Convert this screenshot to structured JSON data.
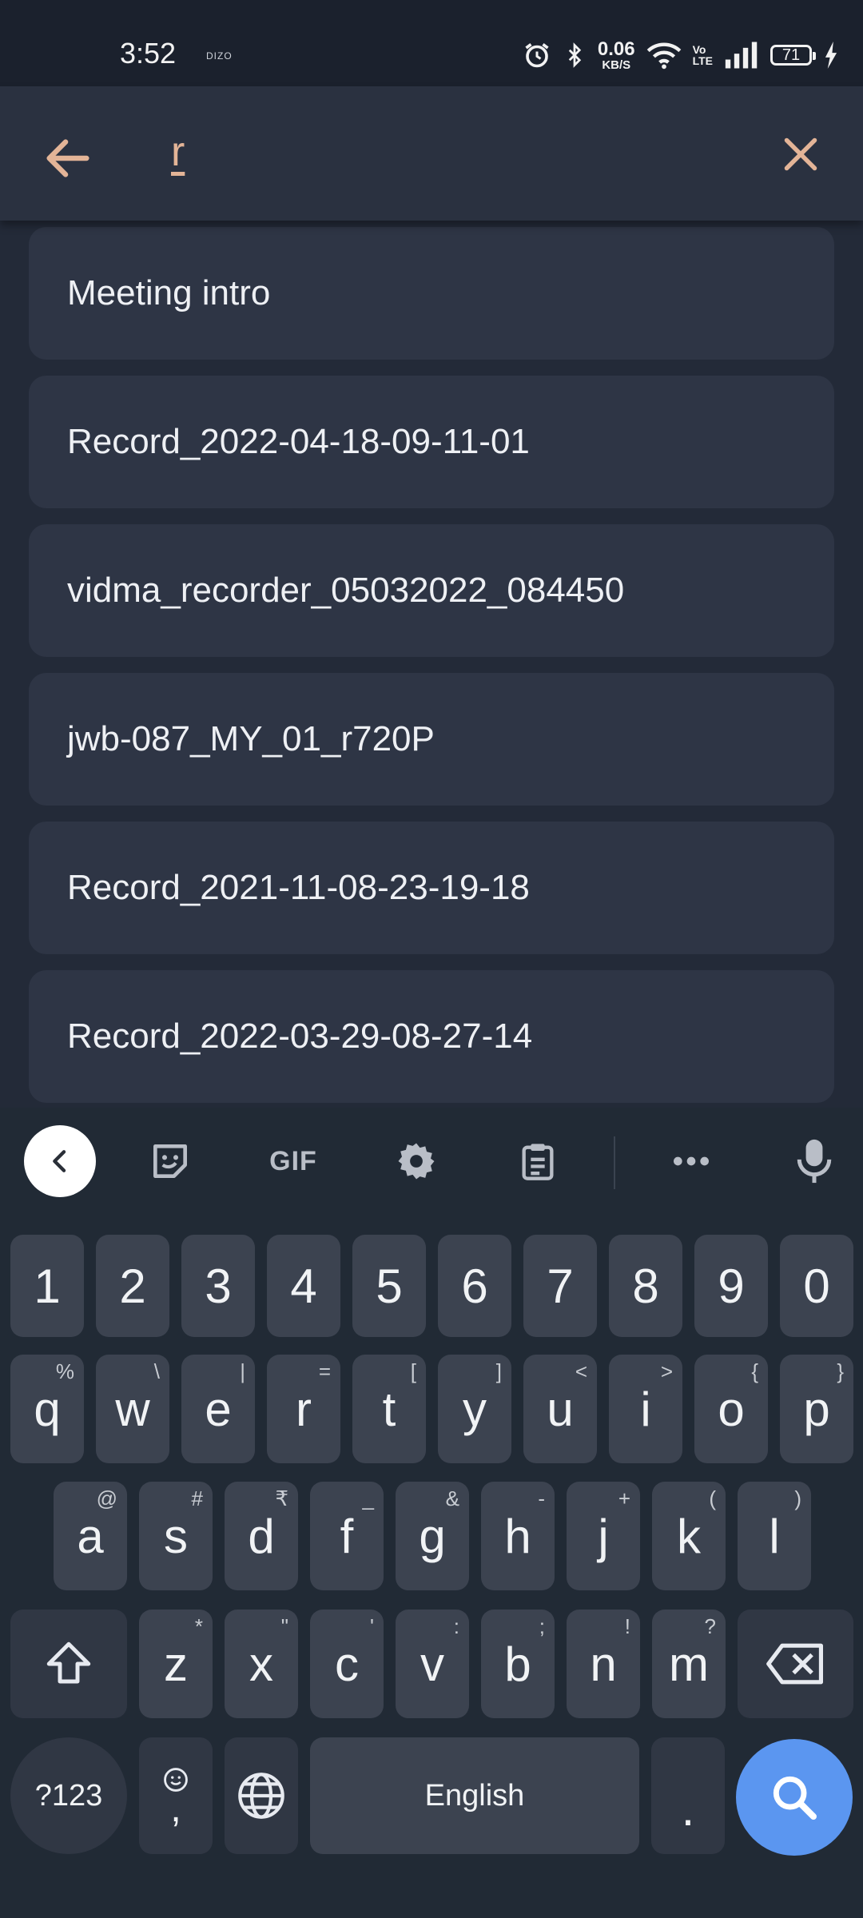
{
  "status_bar": {
    "time": "3:52",
    "carrier_label": "DIZO",
    "speed_value": "0.06",
    "speed_unit": "KB/S",
    "volte_top": "Vo",
    "volte_bottom": "LTE",
    "battery": "71"
  },
  "search": {
    "query": "r"
  },
  "results": [
    "Meeting intro",
    "Record_2022-04-18-09-11-01",
    "vidma_recorder_05032022_084450",
    "jwb-087_MY_01_r720P",
    "Record_2021-11-08-23-19-18",
    "Record_2022-03-29-08-27-14"
  ],
  "keyboard": {
    "toolbar": {
      "gif_label": "GIF"
    },
    "number_row": [
      "1",
      "2",
      "3",
      "4",
      "5",
      "6",
      "7",
      "8",
      "9",
      "0"
    ],
    "row1": [
      {
        "k": "q",
        "s": "%"
      },
      {
        "k": "w",
        "s": "\\"
      },
      {
        "k": "e",
        "s": "|"
      },
      {
        "k": "r",
        "s": "="
      },
      {
        "k": "t",
        "s": "["
      },
      {
        "k": "y",
        "s": "]"
      },
      {
        "k": "u",
        "s": "<"
      },
      {
        "k": "i",
        "s": ">"
      },
      {
        "k": "o",
        "s": "{"
      },
      {
        "k": "p",
        "s": "}"
      }
    ],
    "row2": [
      {
        "k": "a",
        "s": "@"
      },
      {
        "k": "s",
        "s": "#"
      },
      {
        "k": "d",
        "s": "₹"
      },
      {
        "k": "f",
        "s": "_"
      },
      {
        "k": "g",
        "s": "&"
      },
      {
        "k": "h",
        "s": "-"
      },
      {
        "k": "j",
        "s": "+"
      },
      {
        "k": "k",
        "s": "("
      },
      {
        "k": "l",
        "s": ")"
      }
    ],
    "row3": [
      {
        "k": "z",
        "s": "*"
      },
      {
        "k": "x",
        "s": "\""
      },
      {
        "k": "c",
        "s": "'"
      },
      {
        "k": "v",
        "s": ":"
      },
      {
        "k": "b",
        "s": ";"
      },
      {
        "k": "n",
        "s": "!"
      },
      {
        "k": "m",
        "s": "?"
      }
    ],
    "symbols_label": "?123",
    "comma_label": ",",
    "space_label": "English",
    "period_label": ".",
    "colors": {
      "search_key": "#5b96f0",
      "accent": "#e3b497"
    }
  }
}
